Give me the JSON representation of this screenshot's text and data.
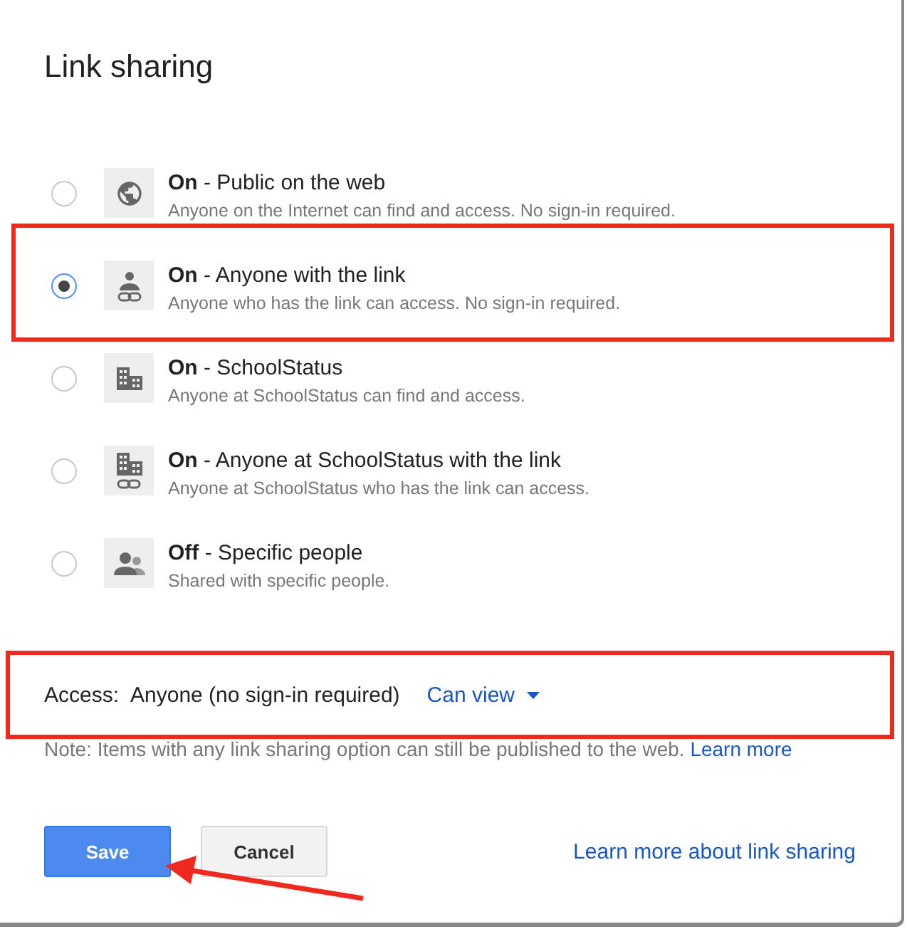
{
  "dialog": {
    "title": "Link sharing"
  },
  "options": [
    {
      "kind": "globe",
      "state": "On",
      "label": "- Public on the web",
      "description": "Anyone on the Internet can find and access. No sign-in required.",
      "selected": false,
      "highlighted": false
    },
    {
      "kind": "person-link",
      "state": "On",
      "label": "- Anyone with the link",
      "description": "Anyone who has the link can access. No sign-in required.",
      "selected": true,
      "highlighted": true
    },
    {
      "kind": "building",
      "state": "On",
      "label": "- SchoolStatus",
      "description": "Anyone at SchoolStatus can find and access.",
      "selected": false,
      "highlighted": false
    },
    {
      "kind": "building-link",
      "state": "On",
      "label": "- Anyone at SchoolStatus with the link",
      "description": "Anyone at SchoolStatus who has the link can access.",
      "selected": false,
      "highlighted": false
    },
    {
      "kind": "people",
      "state": "Off",
      "label": "- Specific people",
      "description": "Shared with specific people.",
      "selected": false,
      "highlighted": false
    }
  ],
  "access": {
    "label": "Access:",
    "value": "Anyone (no sign-in required)",
    "permission": "Can view",
    "highlighted": true
  },
  "note": {
    "text": "Note: Items with any link sharing option can still be published to the web.",
    "link": "Learn more"
  },
  "buttons": {
    "save": "Save",
    "cancel": "Cancel",
    "help_link": "Learn more about link sharing"
  },
  "annotation": {
    "arrow_to_save": true
  }
}
